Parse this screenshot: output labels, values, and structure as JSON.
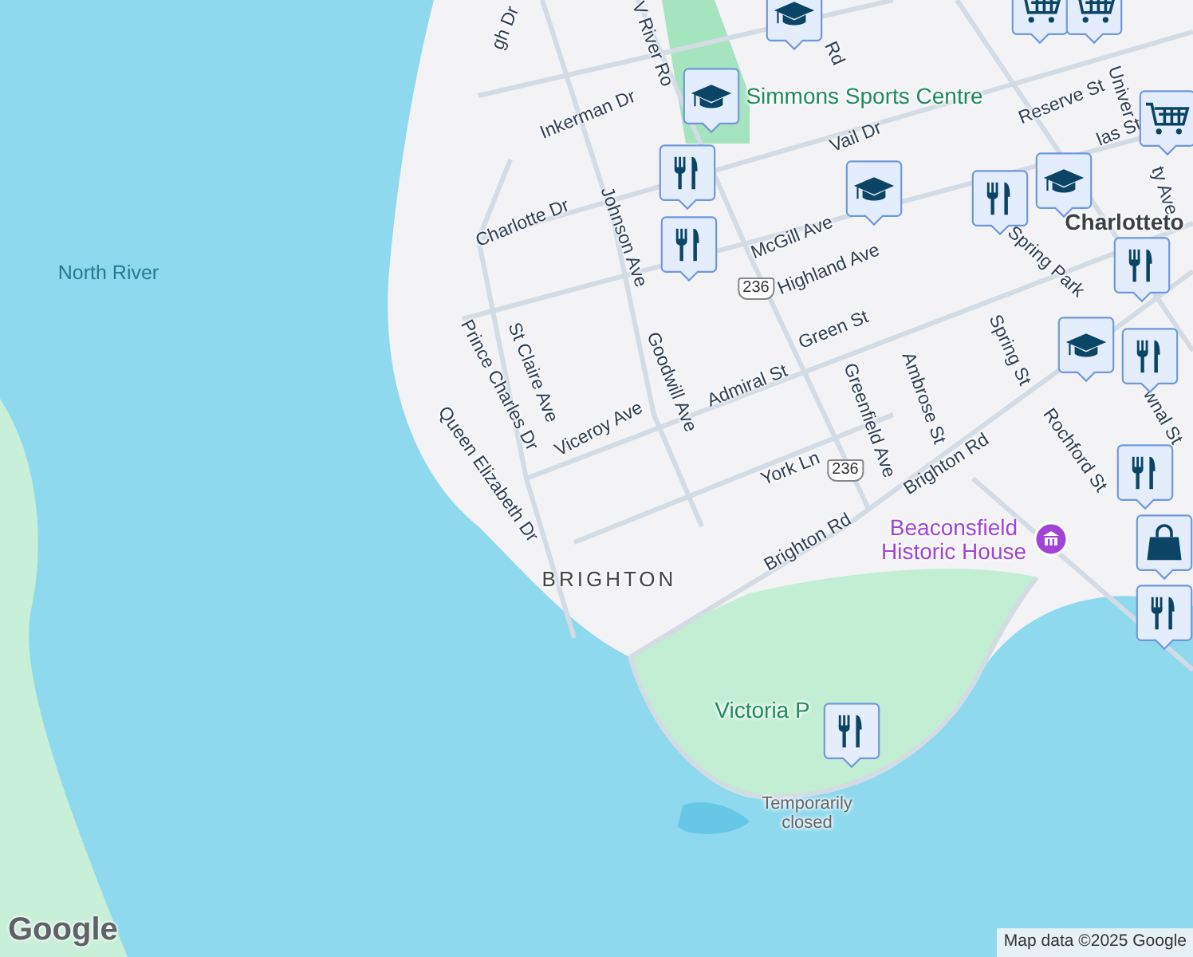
{
  "map": {
    "labels": [
      {
        "text": "gh Dr",
        "kind": "street"
      },
      {
        "text": "V River Ro",
        "kind": "street"
      },
      {
        "text": "Rd",
        "kind": "street"
      },
      {
        "text": "Simmons Sports Centre",
        "kind": "park"
      },
      {
        "text": "Inkerman Dr",
        "kind": "street"
      },
      {
        "text": "Vail Dr",
        "kind": "street"
      },
      {
        "text": "Reserve St",
        "kind": "street"
      },
      {
        "text": "las St",
        "kind": "street"
      },
      {
        "text": "Univer",
        "kind": "street"
      },
      {
        "text": "ty Ave",
        "kind": "street"
      },
      {
        "text": "Charlotte Dr",
        "kind": "street"
      },
      {
        "text": "Johnson Ave",
        "kind": "street"
      },
      {
        "text": "McGill Ave",
        "kind": "street"
      },
      {
        "text": "Highland Ave",
        "kind": "street"
      },
      {
        "text": "Charlotteto",
        "kind": "town"
      },
      {
        "text": "Spring Park",
        "kind": "street"
      },
      {
        "text": "North River",
        "kind": "water"
      },
      {
        "text": "St Claire Ave",
        "kind": "street"
      },
      {
        "text": "Prince Charles Dr",
        "kind": "street"
      },
      {
        "text": "Goodwill Ave",
        "kind": "street"
      },
      {
        "text": "Green St",
        "kind": "street"
      },
      {
        "text": "Viceroy Ave",
        "kind": "street"
      },
      {
        "text": "Admiral St",
        "kind": "street"
      },
      {
        "text": "Greenfield Ave",
        "kind": "street"
      },
      {
        "text": "Ambrose St",
        "kind": "street"
      },
      {
        "text": "Spring St",
        "kind": "street"
      },
      {
        "text": "wnal St",
        "kind": "street"
      },
      {
        "text": "Queen Elizabeth Dr",
        "kind": "street"
      },
      {
        "text": "York Ln",
        "kind": "street"
      },
      {
        "text": "Brighton Rd",
        "kind": "street"
      },
      {
        "text": "Rochford St",
        "kind": "street"
      },
      {
        "text": "Brighton Rd",
        "kind": "street"
      },
      {
        "text": "BRIGHTON",
        "kind": "district"
      },
      {
        "text": "Victoria P",
        "kind": "park"
      },
      {
        "text": "Temporarily closed",
        "kind": "note"
      },
      {
        "text": "Beaconsfield Historic House",
        "kind": "poi"
      },
      {
        "text": "236",
        "kind": "shield"
      },
      {
        "text": "236",
        "kind": "shield"
      }
    ],
    "markers": [
      {
        "kind": "school"
      },
      {
        "kind": "grocery"
      },
      {
        "kind": "grocery"
      },
      {
        "kind": "school"
      },
      {
        "kind": "grocery"
      },
      {
        "kind": "restaurant"
      },
      {
        "kind": "restaurant"
      },
      {
        "kind": "school"
      },
      {
        "kind": "restaurant"
      },
      {
        "kind": "school"
      },
      {
        "kind": "restaurant"
      },
      {
        "kind": "school"
      },
      {
        "kind": "restaurant"
      },
      {
        "kind": "restaurant"
      },
      {
        "kind": "shopping"
      },
      {
        "kind": "restaurant"
      },
      {
        "kind": "restaurant"
      }
    ],
    "logo": "Google",
    "attribution": "Map data ©2025 Google"
  }
}
